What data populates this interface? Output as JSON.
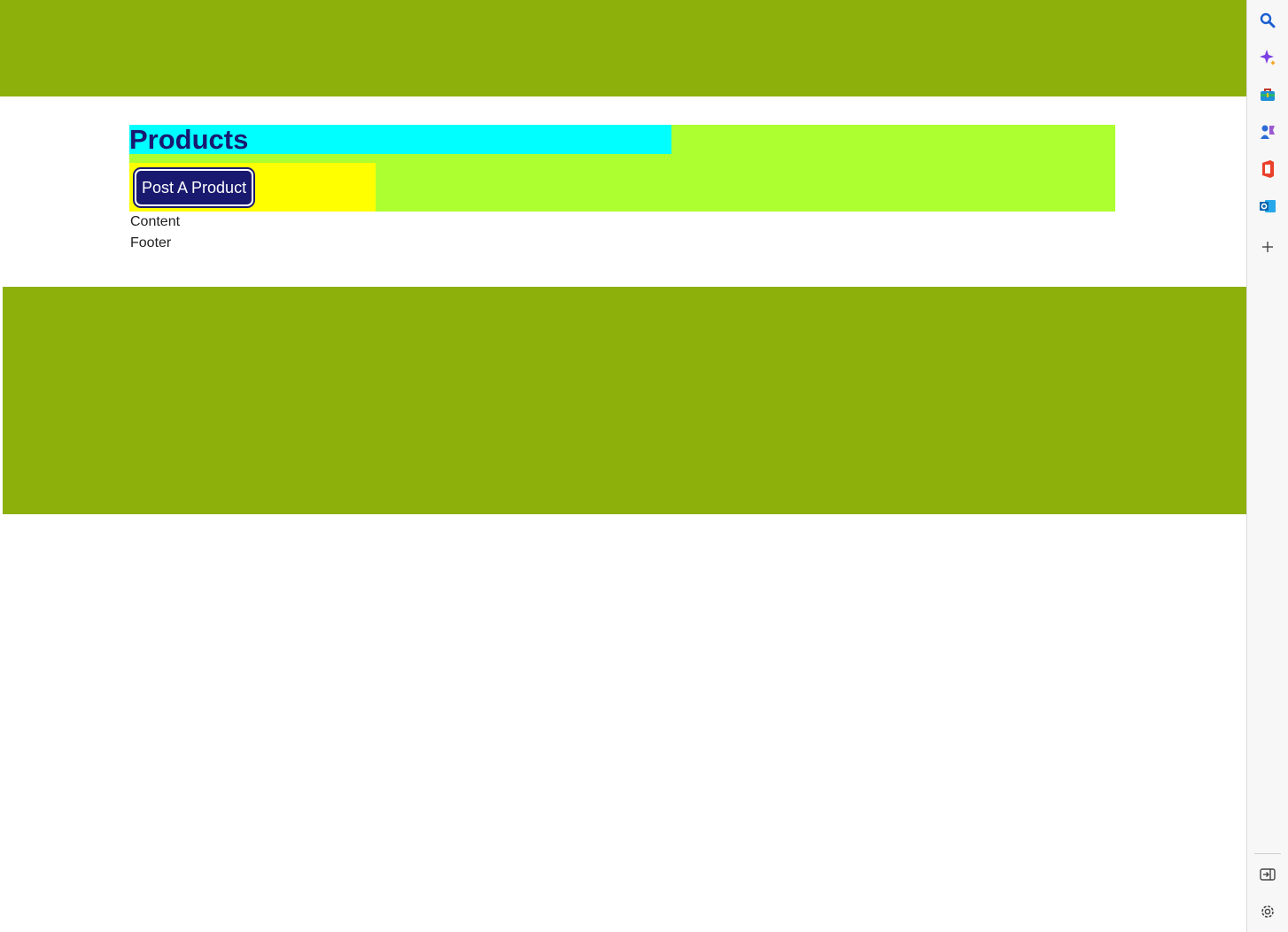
{
  "page": {
    "title": "Products",
    "post_button_label": "Post A Product",
    "content_label": "Content",
    "footer_label": "Footer"
  },
  "colors": {
    "band": "#8db00a",
    "header_bg": "#adff2f",
    "title_bg": "#00ffff",
    "action_bg": "#ffff00",
    "title_text": "#191970",
    "button_bg": "#191970"
  },
  "sidebar": {
    "icons": [
      "search-icon",
      "copilot-icon",
      "shopping-icon",
      "games-icon",
      "office-icon",
      "outlook-icon",
      "add-icon",
      "hide-sidebar-icon",
      "settings-icon"
    ]
  }
}
